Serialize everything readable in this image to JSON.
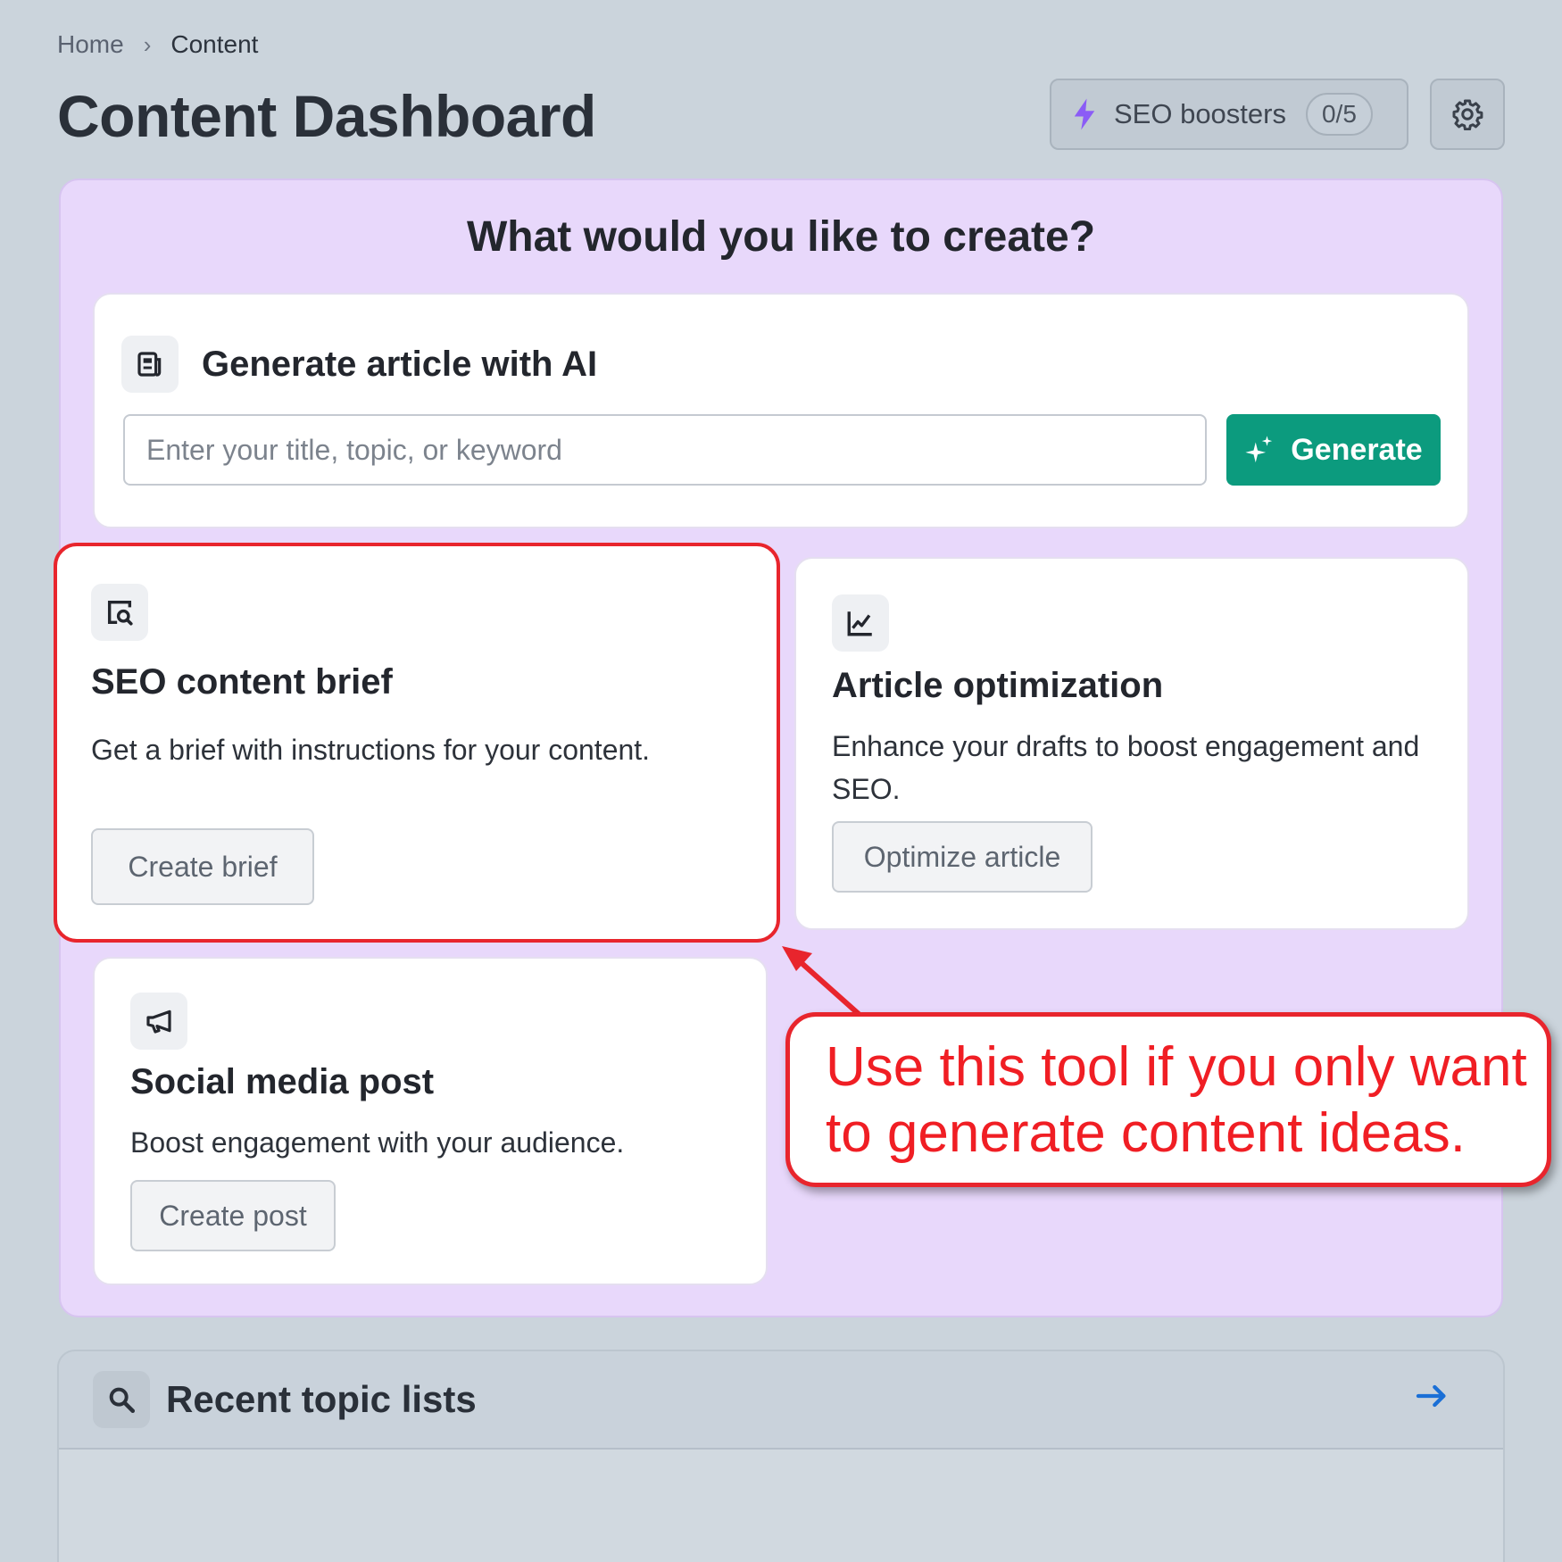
{
  "breadcrumb": {
    "home": "Home",
    "separator": "›",
    "current": "Content"
  },
  "page": {
    "title": "Content Dashboard"
  },
  "header": {
    "boosters_label": "SEO boosters",
    "boosters_count": "0/5",
    "boosters_icon": "lightning-icon",
    "settings_icon": "gear-icon"
  },
  "create": {
    "heading": "What would you like to create?",
    "generate_card": {
      "icon": "article-icon",
      "title": "Generate article with AI",
      "input_placeholder": "Enter your title, topic, or keyword",
      "button_label": "Generate",
      "button_icon": "sparkle-icon"
    },
    "brief_card": {
      "icon": "document-search-icon",
      "title": "SEO content brief",
      "description": "Get a brief with instructions for your content.",
      "button_label": "Create brief"
    },
    "optimization_card": {
      "icon": "line-chart-icon",
      "title": "Article optimization",
      "description": "Enhance your drafts to boost engagement and SEO.",
      "button_label": "Optimize article"
    },
    "social_card": {
      "icon": "megaphone-icon",
      "title": "Social media post",
      "description": "Boost engagement with your audience.",
      "button_label": "Create post"
    }
  },
  "recent": {
    "icon": "search-icon",
    "title": "Recent topic lists",
    "arrow_icon": "arrow-right-icon"
  },
  "annotation": {
    "text": "Use this tool if you only want to generate content ideas."
  },
  "colors": {
    "background": "#cbd4dc",
    "panel": "#e8d8fb",
    "primary_button": "#0c9b7e",
    "booster_icon": "#8b5cf6",
    "annotation": "#e8252d",
    "link_arrow": "#1a6fd6"
  }
}
